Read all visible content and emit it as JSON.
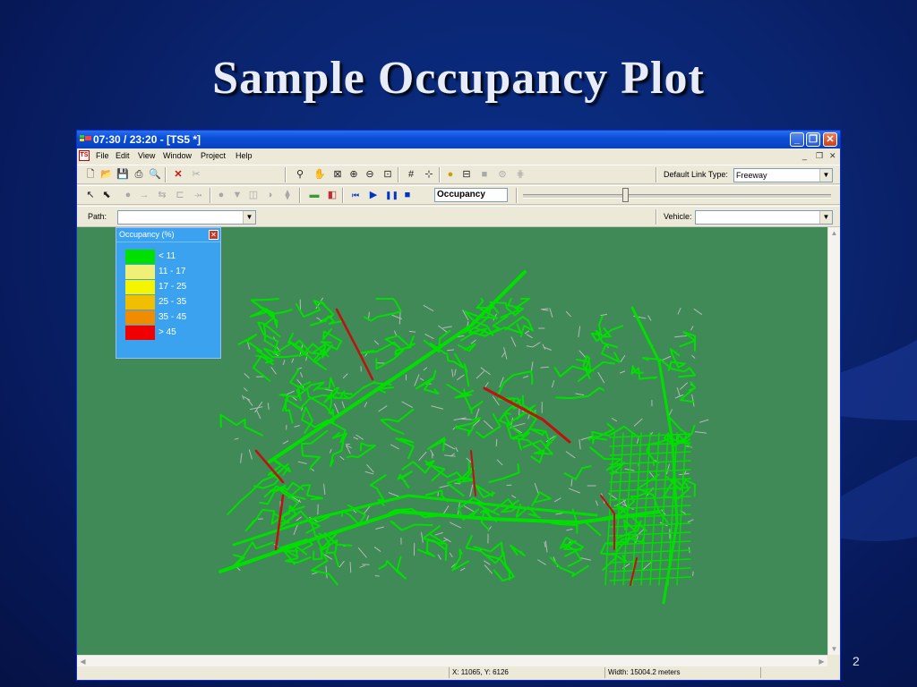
{
  "slide": {
    "title": "Sample Occupancy Plot",
    "page_number": "2",
    "background_color": "#0a2570"
  },
  "window": {
    "title": "07:30 / 23:20 - [TS5 *]",
    "menu": [
      "File",
      "Edit",
      "View",
      "Window",
      "Project",
      "Help"
    ],
    "mdi_controls": [
      "minimize",
      "restore",
      "close"
    ]
  },
  "toolbar1": {
    "icons": [
      "new-icon",
      "open-icon",
      "save-icon",
      "print-icon",
      "print-preview-icon",
      "delete-icon",
      "cut-icon",
      "measure-icon",
      "pan-hand-icon",
      "zoom-box-icon",
      "zoom-in-icon",
      "zoom-out-icon",
      "zoom-extent-icon",
      "grid-icon",
      "node-icon",
      "signal-icon",
      "stop-sign-icon",
      "detector-icon",
      "lane-icon",
      "export-icon"
    ],
    "default_link_type_label": "Default Link Type:",
    "default_link_type_value": "Freeway"
  },
  "toolbar2": {
    "icons": [
      "select-arrow-icon",
      "select-node-icon",
      "circle-icon",
      "arrow-right-icon",
      "two-way-icon",
      "link-icon",
      "merge-icon",
      "dot-icon",
      "triangle-icon",
      "lanes-icon",
      "split-icon",
      "pipe-icon",
      "chart-icon",
      "map-icon",
      "rewind-icon",
      "play-icon",
      "pause-icon",
      "stop-icon"
    ],
    "display_mode": "Occupancy",
    "time_slider_fraction": 0.33
  },
  "pathbar": {
    "path_label": "Path:",
    "path_value": "",
    "vehicle_label": "Vehicle:",
    "vehicle_value": ""
  },
  "legend": {
    "title": "Occupancy (%)",
    "items": [
      {
        "range": "< 11",
        "color": "#00e000"
      },
      {
        "range": "11 - 17",
        "color": "#f0f078"
      },
      {
        "range": "17 - 25",
        "color": "#f5f500"
      },
      {
        "range": "25 - 35",
        "color": "#f0c000"
      },
      {
        "range": "35 - 45",
        "color": "#f08c00"
      },
      {
        "range": "> 45",
        "color": "#f00000"
      }
    ]
  },
  "map": {
    "background_color": "#3f8a56",
    "low_color": "#00e000",
    "minor_color": "#b8b8b8",
    "high_color": "#c01010"
  },
  "status": {
    "coords": "X: 11065, Y: 6126",
    "width": "Width: 15004.2 meters"
  }
}
